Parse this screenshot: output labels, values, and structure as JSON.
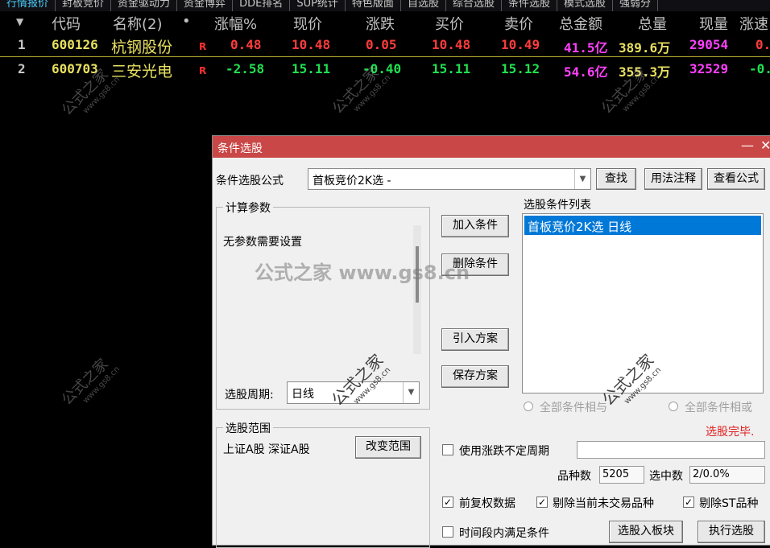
{
  "tabs": [
    "行情报价",
    "封板竞价",
    "资金驱动力",
    "资金博弈",
    "DDE排名",
    "SUP统计",
    "特色版面",
    "自选股",
    "综合选股",
    "条件选股",
    "模式选股",
    "强弱分"
  ],
  "columns": [
    "▼",
    "代码",
    "名称(2)",
    "•",
    "涨幅%",
    "现价",
    "涨跌",
    "买价",
    "卖价",
    "总金额",
    "总量",
    "现量",
    "涨速"
  ],
  "rows": [
    {
      "idx": "1",
      "code": "600126",
      "name": "杭钢股份",
      "tag": "R",
      "pct": "0.48",
      "price": "10.48",
      "chg": "0.05",
      "bid": "10.48",
      "ask": "10.49",
      "amount": "41.5亿",
      "volume": "389.6万",
      "vol_now": "29054",
      "speed": "0."
    },
    {
      "idx": "2",
      "code": "600703",
      "name": "三安光电",
      "tag": "R",
      "pct": "-2.58",
      "price": "15.11",
      "chg": "-0.40",
      "bid": "15.11",
      "ask": "15.12",
      "amount": "54.6亿",
      "volume": "355.3万",
      "vol_now": "32529",
      "speed": "-0."
    }
  ],
  "colors": {
    "red": "#ff3c3c",
    "green": "#20e050",
    "yellow": "#e8e060",
    "magenta": "#ff40ff",
    "title_bar": "#c94747",
    "selection": "#0078d7"
  },
  "watermark": {
    "text": "公式之家",
    "url": "www.gs8.cn",
    "center": "公式之家 www.gs8.cn"
  },
  "dialog": {
    "title": "条件选股",
    "formula_label": "条件选股公式",
    "formula_value": "首板竞价2K选  -",
    "btn_find": "查找",
    "btn_usage": "用法注释",
    "btn_view": "查看公式",
    "params_title": "计算参数",
    "params_text": "无参数需要设置",
    "period_label": "选股周期:",
    "period_value": "日线",
    "range_title": "选股范围",
    "range_text": "上证A股 深证A股",
    "btn_change_range": "改变范围",
    "btn_add": "加入条件",
    "btn_delete": "删除条件",
    "btn_import": "引入方案",
    "btn_save": "保存方案",
    "list_title": "选股条件列表",
    "list_items": [
      "首板竞价2K选  日线"
    ],
    "radio_and": "全部条件相与",
    "radio_or": "全部条件相或",
    "status": "选股完毕.",
    "chk_variable_period": "使用涨跌不定周期",
    "count_label": "品种数",
    "count_value": "5205",
    "selected_label": "选中数",
    "selected_value": "2/0.0%",
    "chk_adjust": "前复权数据",
    "chk_remove_untraded": "剔除当前未交易品种",
    "chk_remove_st": "剔除ST品种",
    "chk_time_range": "时间段内满足条件",
    "btn_to_block": "选股入板块",
    "btn_execute": "执行选股"
  }
}
